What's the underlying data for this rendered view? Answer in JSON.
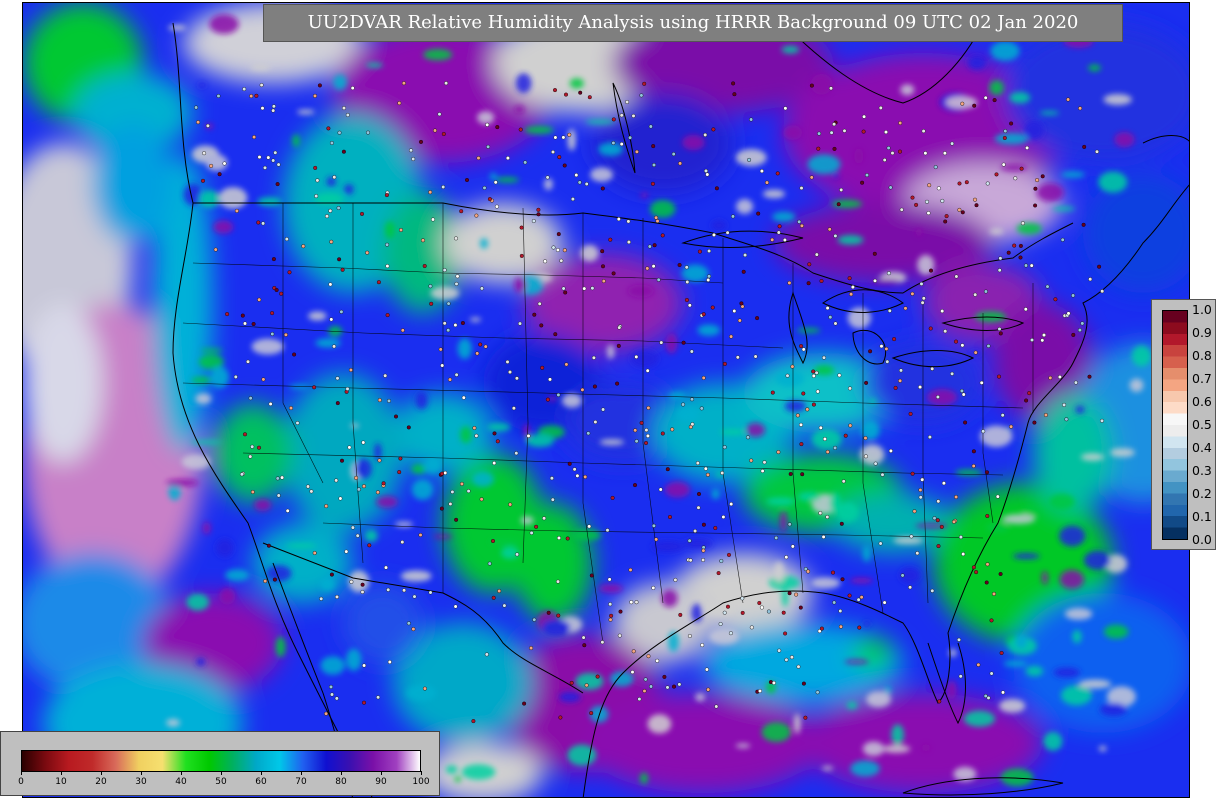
{
  "map": {
    "title": "UU2DVAR Relative Humidity Analysis using HRRR Background 09 UTC 02 Jan 2020",
    "region": "CONUS",
    "colors": {
      "ocean_green": "#00cc22",
      "cyan": "#00b8d8",
      "blue": "#0a1ef0",
      "purple": "#8a0aa8",
      "grey": "#d0d0d0",
      "borders": "#000000"
    }
  },
  "rh_legend": {
    "ticks": [
      "0",
      "10",
      "20",
      "30",
      "40",
      "50",
      "60",
      "70",
      "80",
      "90",
      "100"
    ],
    "colors": [
      "#2a0000",
      "#7a0a10",
      "#b81a20",
      "#c02a2a",
      "#d86a5a",
      "#f0d060",
      "#f6e070",
      "#20e020",
      "#00c800",
      "#00b060",
      "#00a8c8",
      "#00c8e8",
      "#2060f0",
      "#1010d0",
      "#3a10b0",
      "#7a10a8",
      "#a040c0",
      "#ffffff"
    ]
  },
  "obs_legend": {
    "ticks": [
      "1.0",
      "0.9",
      "0.8",
      "0.7",
      "0.6",
      "0.5",
      "0.4",
      "0.3",
      "0.2",
      "0.1",
      "0.0"
    ],
    "colors": [
      "#67001f",
      "#8c0b1e",
      "#b2182b",
      "#c8433e",
      "#d6604d",
      "#e58e6c",
      "#f4a582",
      "#f7c8ad",
      "#fddbc7",
      "#f7f7f7",
      "#ededed",
      "#d1e5f0",
      "#b3cde0",
      "#92c5de",
      "#6aaacf",
      "#4393c3",
      "#3276b1",
      "#2166ac",
      "#114a87",
      "#053061"
    ]
  }
}
